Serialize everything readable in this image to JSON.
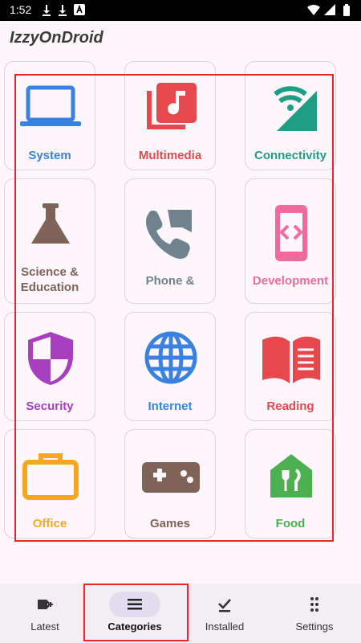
{
  "status_bar": {
    "time": "1:52"
  },
  "app": {
    "title": "IzzyOnDroid"
  },
  "categories": [
    {
      "label": "System",
      "color": "#3b82e0",
      "icon": "laptop-icon"
    },
    {
      "label": "Multimedia",
      "color": "#e5484d",
      "icon": "music-library-icon"
    },
    {
      "label": "Connectivity",
      "color": "#1e9e85",
      "icon": "wifi-signal-icon"
    },
    {
      "label": "Science & Education",
      "color": "#7f6358",
      "icon": "flask-icon"
    },
    {
      "label": "Phone &",
      "color": "#6f828e",
      "icon": "phone-forward-icon"
    },
    {
      "label": "Development",
      "color": "#f06a9c",
      "icon": "code-device-icon"
    },
    {
      "label": "Security",
      "color": "#a83fbf",
      "icon": "shield-icon"
    },
    {
      "label": "Internet",
      "color": "#3b82e0",
      "icon": "globe-icon"
    },
    {
      "label": "Reading",
      "color": "#e5484d",
      "icon": "book-icon"
    },
    {
      "label": "Office",
      "color": "#f5a623",
      "icon": "briefcase-icon"
    },
    {
      "label": "Games",
      "color": "#7f6358",
      "icon": "gamepad-icon"
    },
    {
      "label": "Food",
      "color": "#4caf50",
      "icon": "restaurant-icon"
    }
  ],
  "bottom_nav": {
    "items": [
      {
        "label": "Latest",
        "icon": "new-releases-icon"
      },
      {
        "label": "Categories",
        "icon": "menu-icon",
        "selected": true
      },
      {
        "label": "Installed",
        "icon": "download-done-icon"
      },
      {
        "label": "Settings",
        "icon": "apps-grid-icon"
      }
    ]
  }
}
